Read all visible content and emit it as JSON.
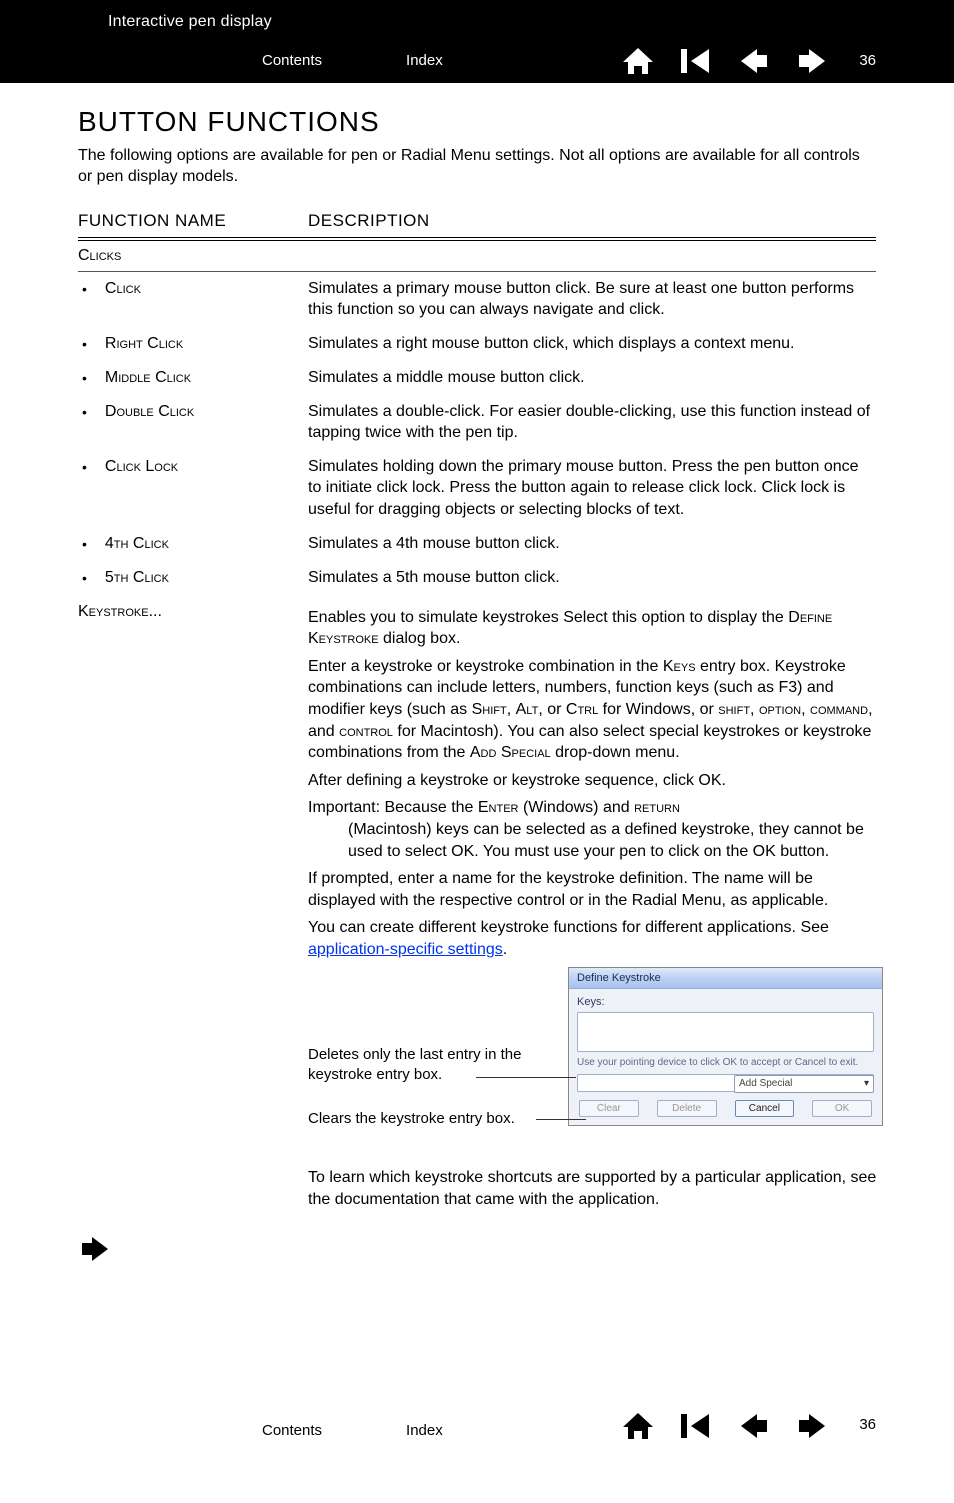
{
  "header": {
    "doc_title": "Interactive pen display",
    "contents_label": "Contents",
    "index_label": "Index",
    "page_number": "36"
  },
  "page_title": "BUTTON FUNCTIONS",
  "intro": "The following options are available for pen or Radial Menu settings.  Not all options are available for all controls or pen display models.",
  "columns": {
    "name": "FUNCTION NAME",
    "desc": "DESCRIPTION"
  },
  "clicks_category": "Clicks",
  "clicks": [
    {
      "name": "Click",
      "desc": "Simulates a primary mouse button click.  Be sure at least one button performs this function so you can always navigate and click."
    },
    {
      "name": "Right Click",
      "desc": "Simulates a right mouse button click, which displays a context menu."
    },
    {
      "name": "Middle Click",
      "desc": "Simulates a middle mouse button click."
    },
    {
      "name": "Double Click",
      "desc": "Simulates a double-click.  For easier double-clicking, use this function instead of tapping twice with the pen tip."
    },
    {
      "name": "Click Lock",
      "desc": "Simulates holding down the primary mouse button.  Press the pen button once to initiate click lock.  Press the button again to release click lock.  Click lock is useful for dragging objects or selecting blocks of text."
    },
    {
      "name": "4th Click",
      "desc": "Simulates a 4th mouse button click."
    },
    {
      "name": "5th Click",
      "desc": "Simulates a 5th mouse button click."
    }
  ],
  "keystroke": {
    "name": "Keystroke...",
    "p1a": "Enables you to simulate keystrokes  Select this option to display the ",
    "p1b": "Define Keystroke",
    "p1c": " dialog box.",
    "p2a": "Enter a keystroke or keystroke combination in the ",
    "p2b": "Keys",
    "p2c": " entry box.  Keystroke combinations can include letters, numbers, function keys (such as F3) and modifier keys (such as ",
    "p2d": "Shift",
    "p2e": ", ",
    "p2f": "Alt",
    "p2g": ", or ",
    "p2h": "Ctrl",
    "p2i": " for Windows, or ",
    "p2j": "shift",
    "p2k": ", ",
    "p2l": "option",
    "p2m": ", ",
    "p2n": "command",
    "p2o": ", and ",
    "p2p": "control",
    "p2q": " for Macintosh).  You can also select special keystrokes or keystroke combinations from the ",
    "p2r": "Add Special",
    "p2s": " drop-down menu.",
    "p3": "After defining a keystroke or keystroke sequence, click OK.",
    "p4a": "Important: Because the ",
    "p4b": "Enter",
    "p4c": " (Windows) and ",
    "p4d": "return",
    "p4e": " (Macintosh) keys can be selected as a defined keystroke, they cannot be used to select OK. You must use your pen to click on the OK button.",
    "p5": "If prompted, enter a name for the keystroke definition.  The name will be displayed with the respective control or in the Radial Menu, as applicable.",
    "p6a": "You can create different keystroke functions for different applications.  See ",
    "p6link": "application-specific settings",
    "p6b": "."
  },
  "callouts": {
    "delete_note": "Deletes only the last entry in the keystroke entry box.",
    "clear_note": "Clears the keystroke entry box."
  },
  "dialog": {
    "title": "Define Keystroke",
    "keys_label": "Keys:",
    "hint": "Use your pointing device to click OK to accept or Cancel to exit.",
    "add_special": "Add Special",
    "btn_clear": "Clear",
    "btn_delete": "Delete",
    "btn_cancel": "Cancel",
    "btn_ok": "OK"
  },
  "footer_note": "To learn which keystroke shortcuts are supported by a particular application, see the documentation that came with the application."
}
